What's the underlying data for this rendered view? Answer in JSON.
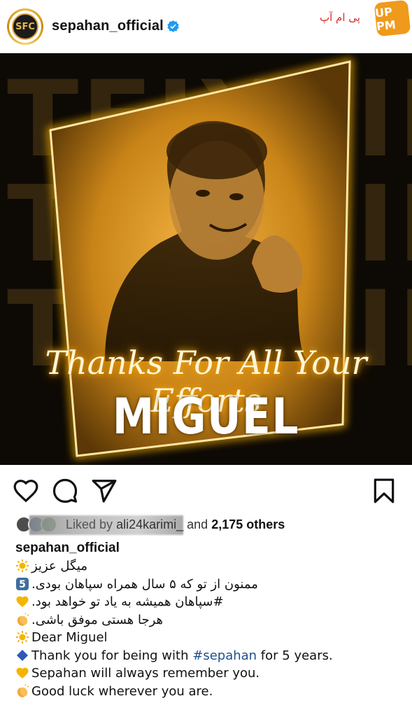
{
  "header": {
    "username": "sepahan_official",
    "verified": true,
    "avatar_label": "SFC",
    "watermark": {
      "text": "پی ام آپ",
      "badge": "UP PM"
    }
  },
  "post": {
    "background_words": [
      "TEIXEIRA",
      "TEIXEIRA",
      "TEIXEIRA"
    ],
    "title": "Thanks For All Your Efforts",
    "name": "MIGUEL",
    "accent_color": "#f2a623"
  },
  "actions": {
    "like": "heart-icon",
    "comment": "comment-icon",
    "share": "share-icon",
    "save": "bookmark-icon"
  },
  "likes": {
    "prefix": "Liked by",
    "user": "ali24karimi_",
    "suffix": "and",
    "count": "2,175 others"
  },
  "caption": {
    "username": "sepahan_official",
    "lines": [
      {
        "emoji": "sun",
        "text": "میگل عزیز",
        "rtl": true
      },
      {
        "emoji": "five",
        "text": "ممنون از تو که ۵ سال همراه سپاهان بودی.",
        "rtl": true
      },
      {
        "emoji": "heart",
        "text": "#سپاهان همیشه به یاد تو خواهد بود.",
        "rtl": true
      },
      {
        "emoji": "clap",
        "text": "هرجا هستی موفق باشی.",
        "rtl": true
      },
      {
        "emoji": "sun",
        "text": "Dear Miguel",
        "rtl": false
      },
      {
        "emoji": "diamond",
        "text_before": "Thank you for being with ",
        "hashtag": "#sepahan",
        "text_after": " for 5 years.",
        "rtl": false
      },
      {
        "emoji": "heart",
        "text": "Sepahan will always remember you.",
        "rtl": false
      },
      {
        "emoji": "clap",
        "text": "Good luck wherever you are.",
        "rtl": false
      }
    ]
  }
}
